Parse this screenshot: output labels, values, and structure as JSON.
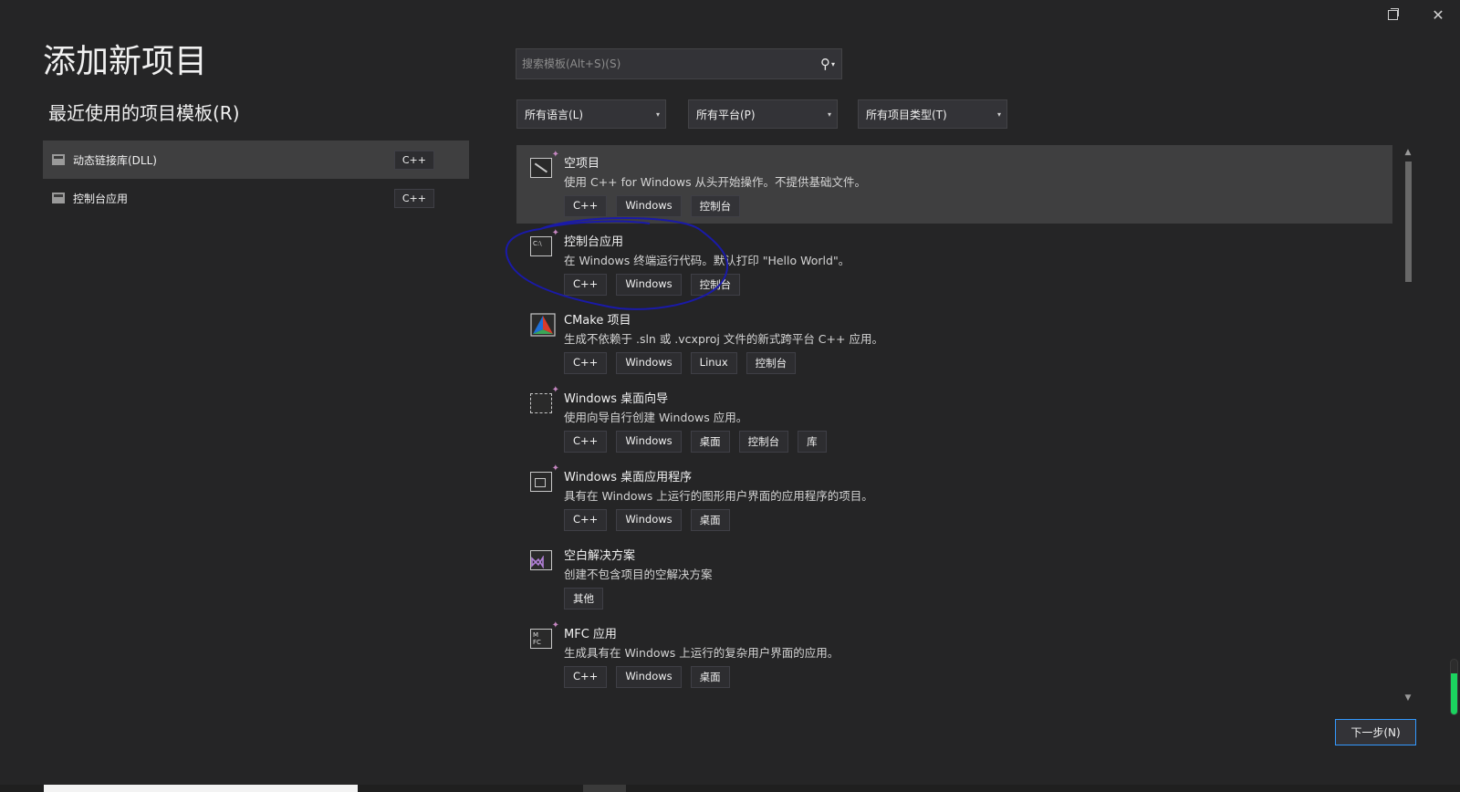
{
  "window": {
    "restore_label": "restore-window",
    "close_label": "✕"
  },
  "page": {
    "title": "添加新项目",
    "recent_title": "最近使用的项目模板(R)"
  },
  "recent": [
    {
      "label": "动态链接库(DLL)",
      "lang": "C++",
      "icon": "dll-icon",
      "selected": true
    },
    {
      "label": "控制台应用",
      "lang": "C++",
      "icon": "console-app-icon",
      "selected": false
    }
  ],
  "search": {
    "placeholder": "搜索模板(Alt+S)(S)",
    "value": ""
  },
  "filters": {
    "language": "所有语言(L)",
    "platform": "所有平台(P)",
    "project_type": "所有项目类型(T)"
  },
  "templates": [
    {
      "name": "空项目",
      "desc": "使用 C++ for Windows 从头开始操作。不提供基础文件。",
      "tags": [
        "C++",
        "Windows",
        "控制台"
      ],
      "icon": "empty-project-icon",
      "selected": true
    },
    {
      "name": "控制台应用",
      "desc": "在 Windows 终端运行代码。默认打印 \"Hello World\"。",
      "tags": [
        "C++",
        "Windows",
        "控制台"
      ],
      "icon": "console-app-icon",
      "selected": false
    },
    {
      "name": "CMake 项目",
      "desc": "生成不依赖于 .sln 或 .vcxproj 文件的新式跨平台 C++ 应用。",
      "tags": [
        "C++",
        "Windows",
        "Linux",
        "控制台"
      ],
      "icon": "cmake-icon",
      "selected": false
    },
    {
      "name": "Windows 桌面向导",
      "desc": "使用向导自行创建 Windows 应用。",
      "tags": [
        "C++",
        "Windows",
        "桌面",
        "控制台",
        "库"
      ],
      "icon": "desktop-wizard-icon",
      "selected": false
    },
    {
      "name": "Windows 桌面应用程序",
      "desc": "具有在 Windows 上运行的图形用户界面的应用程序的项目。",
      "tags": [
        "C++",
        "Windows",
        "桌面"
      ],
      "icon": "desktop-app-icon",
      "selected": false
    },
    {
      "name": "空白解决方案",
      "desc": "创建不包含项目的空解决方案",
      "tags": [
        "其他"
      ],
      "icon": "blank-solution-icon",
      "selected": false
    },
    {
      "name": "MFC 应用",
      "desc": "生成具有在 Windows 上运行的复杂用户界面的应用。",
      "tags": [
        "C++",
        "Windows",
        "桌面"
      ],
      "icon": "mfc-app-icon",
      "selected": false
    }
  ],
  "buttons": {
    "next": "下一步(N)"
  },
  "colors": {
    "background": "#252526",
    "selected_row": "#3f3f40",
    "accent_border": "#3399ff",
    "annotation": "#1a1aa8",
    "sparkle": "#c586c0"
  },
  "gauge": {
    "level": 0.75
  }
}
